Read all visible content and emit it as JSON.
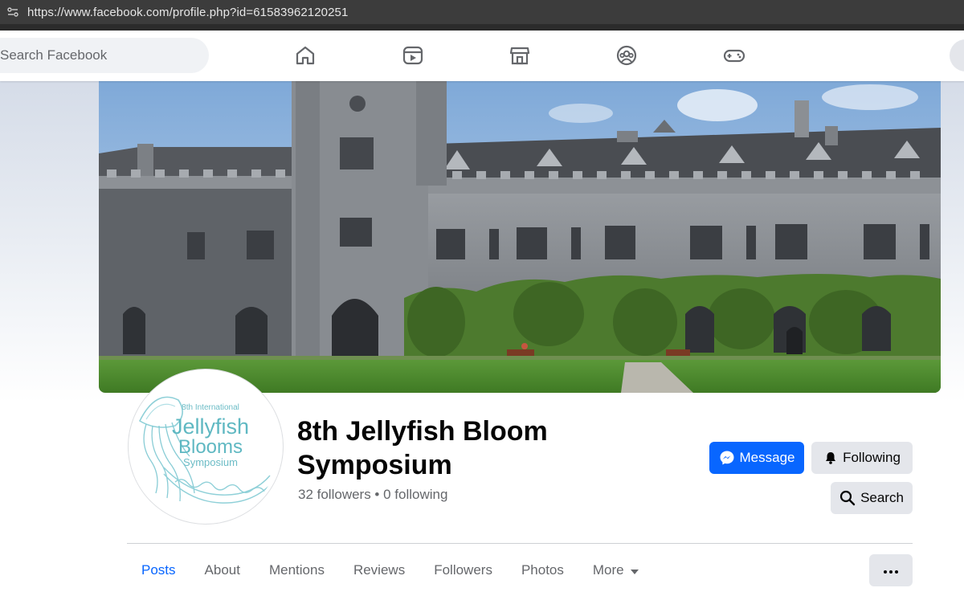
{
  "browser": {
    "url": "https://www.facebook.com/profile.php?id=61583962120251"
  },
  "nav": {
    "search_placeholder": "Search Facebook",
    "icons": [
      "home-icon",
      "video-icon",
      "marketplace-icon",
      "groups-icon",
      "gaming-icon"
    ]
  },
  "profile": {
    "name": "8th Jellyfish Bloom Symposium",
    "stats": "32 followers • 0 following",
    "logo": {
      "line1": "8th International",
      "line2": "Jellyfish",
      "line3": "Blooms",
      "line4": "Symposium"
    }
  },
  "actions": {
    "message": "Message",
    "following": "Following",
    "search": "Search"
  },
  "tabs": [
    {
      "label": "Posts",
      "active": true
    },
    {
      "label": "About",
      "active": false
    },
    {
      "label": "Mentions",
      "active": false
    },
    {
      "label": "Reviews",
      "active": false
    },
    {
      "label": "Followers",
      "active": false
    },
    {
      "label": "Photos",
      "active": false
    },
    {
      "label": "More",
      "active": false
    }
  ],
  "colors": {
    "accent": "#0866ff",
    "secondary_button": "#e4e6eb",
    "text_muted": "#65676b",
    "logo_teal": "#5fb8c2"
  }
}
